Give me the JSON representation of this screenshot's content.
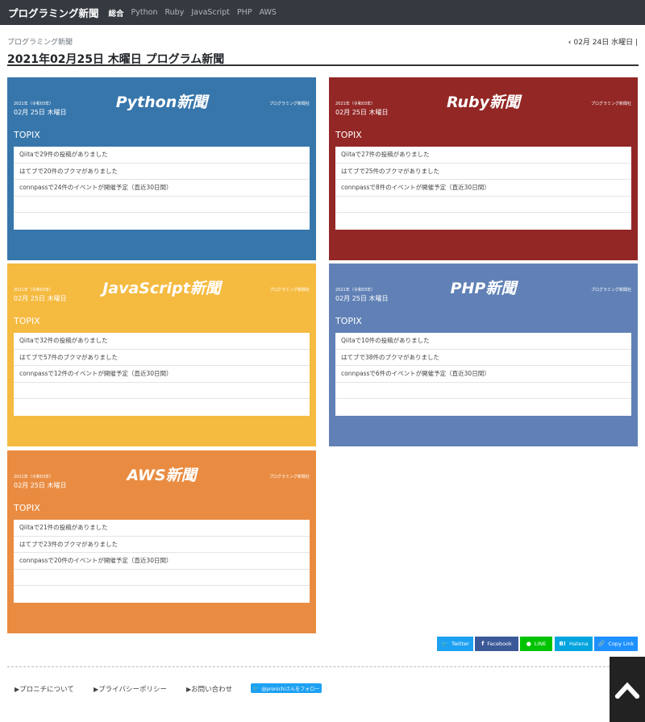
{
  "nav": {
    "brand": "プログラミング新聞",
    "links": [
      "総合",
      "Python",
      "Ruby",
      "JavaScript",
      "PHP",
      "AWS"
    ]
  },
  "header": {
    "breadcrumb": "プログラミング新聞",
    "prev_day": "02月 24日 水曜日 |",
    "title": "2021年02月25日 木曜日 プログラム新聞"
  },
  "colors": {
    "python": "#3776ab",
    "ruby": "#922725",
    "javascript": "#f5ba40",
    "php": "#6181b6",
    "aws": "#e98c42",
    "navbar": "#343a40"
  },
  "cards": [
    {
      "title": "Python新聞",
      "era": "2021年（令和03年）",
      "date": "02月 25日 木曜日",
      "publisher": "プログラミング新聞社",
      "topix": "TOPIX",
      "items": [
        "Qiitaで29件の投稿がありました",
        "はてブで20件のブクマがありました",
        "connpassで24件のイベントが開催予定（直近30日間）",
        "",
        ""
      ]
    },
    {
      "title": "Ruby新聞",
      "era": "2021年（令和03年）",
      "date": "02月 25日 木曜日",
      "publisher": "プログラミング新聞社",
      "topix": "TOPIX",
      "items": [
        "Qiitaで27件の投稿がありました",
        "はてブで25件のブクマがありました",
        "connpassで8件のイベントが開催予定（直近30日間）",
        "",
        ""
      ]
    },
    {
      "title": "JavaScript新聞",
      "era": "2021年（令和03年）",
      "date": "02月 25日 木曜日",
      "publisher": "プログラミング新聞社",
      "topix": "TOPIX",
      "items": [
        "Qiitaで32件の投稿がありました",
        "はてブで57件のブクマがありました",
        "connpassで12件のイベントが開催予定（直近30日間）",
        "",
        ""
      ]
    },
    {
      "title": "PHP新聞",
      "era": "2021年（令和03年）",
      "date": "02月 25日 木曜日",
      "publisher": "プログラミング新聞社",
      "topix": "TOPIX",
      "items": [
        "Qiitaで10件の投稿がありました",
        "はてブで38件のブクマがありました",
        "connpassで6件のイベントが開催予定（直近30日間）",
        "",
        ""
      ]
    },
    {
      "title": "AWS新聞",
      "era": "2021年（令和03年）",
      "date": "02月 25日 木曜日",
      "publisher": "プログラミング新聞社",
      "topix": "TOPIX",
      "items": [
        "Qiitaで21件の投稿がありました",
        "はてブで23件のブクマがありました",
        "connpassで20件のイベントが開催予定（直近30日間）",
        "",
        ""
      ]
    }
  ],
  "share": {
    "twitter": "Twitter",
    "facebook": "Facebook",
    "line": "LINE",
    "hatena": "Hatena",
    "copy": "Copy Link",
    "twitter_color": "#1da1f2",
    "facebook_color": "#3b5998",
    "line_color": "#00c300",
    "hatena_color": "#00a4de"
  },
  "footer": {
    "about": "プロニチについて",
    "privacy": "プライバシーポリシー",
    "contact": "お問い合わせ",
    "follow": "@pronichiさんをフォロー"
  }
}
